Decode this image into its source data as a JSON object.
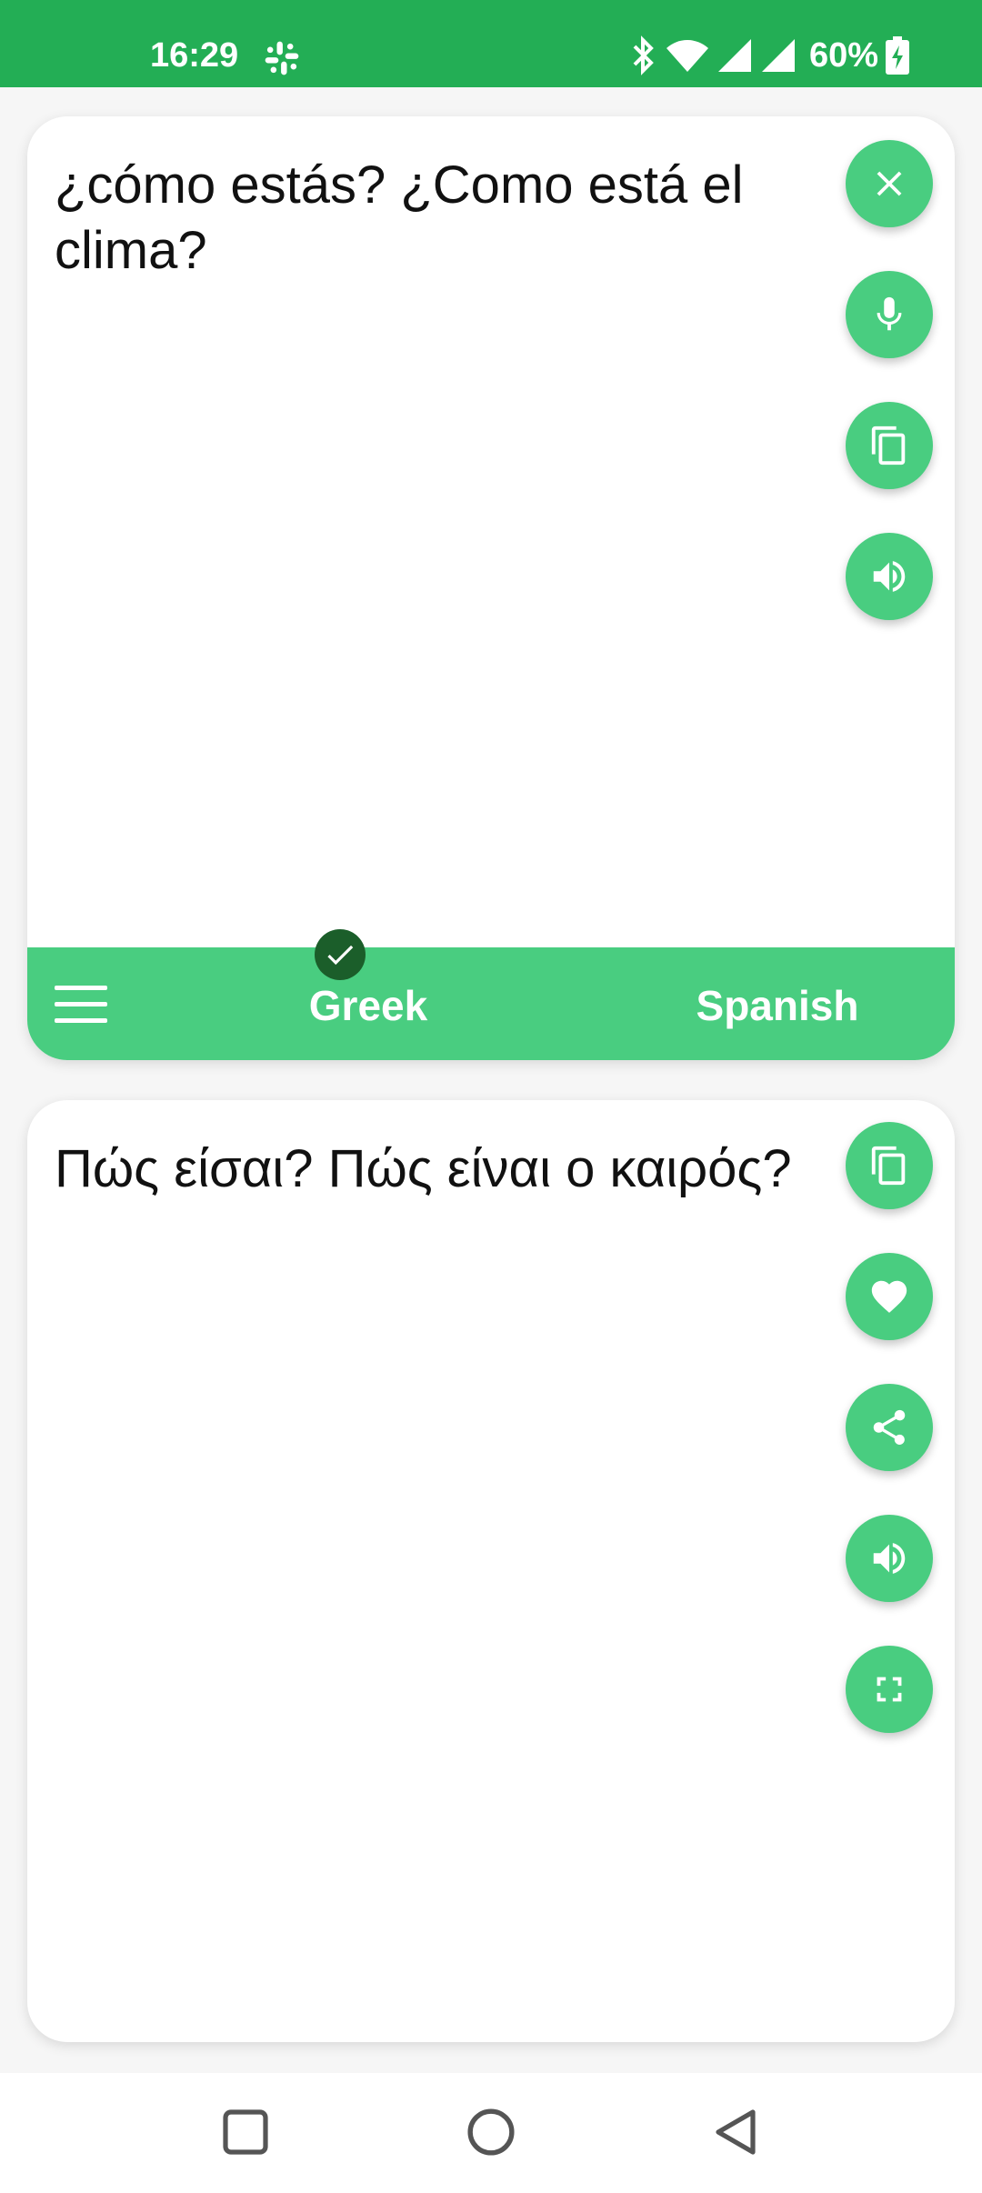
{
  "status_bar": {
    "time": "16:29",
    "battery": "60%",
    "notification_icon": "slack-icon",
    "icons": [
      "bluetooth-icon",
      "wifi-icon",
      "signal-icon",
      "signal-icon",
      "battery-charging-icon"
    ]
  },
  "source_panel": {
    "text": "¿cómo estás? ¿Como está el clima?",
    "buttons": [
      "clear-icon",
      "mic-icon",
      "copy-icon",
      "speaker-icon"
    ]
  },
  "language_bar": {
    "source_language": "Greek",
    "target_language": "Spanish",
    "selected": "Greek"
  },
  "translation_panel": {
    "text": "Πώς είσαι? Πώς είναι ο καιρός?",
    "buttons": [
      "copy-icon",
      "heart-icon",
      "share-icon",
      "speaker-icon",
      "fullscreen-icon"
    ]
  },
  "colors": {
    "status_bar": "#23ae55",
    "accent": "#49cd80",
    "check_badge": "#1b5e2a",
    "background": "#f6f6f6"
  }
}
